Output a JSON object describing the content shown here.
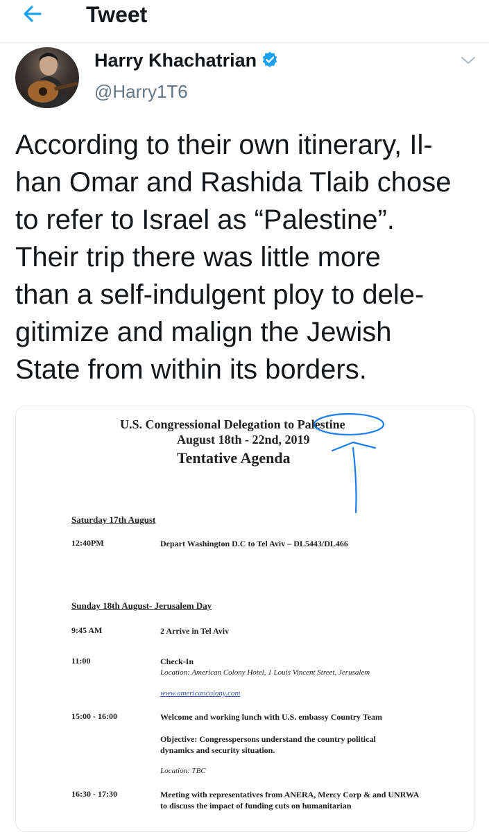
{
  "header": {
    "back_icon": "arrow-left-icon",
    "title": "Tweet"
  },
  "author": {
    "name": "Harry Khachatrian",
    "handle": "@Harry1T6",
    "verified_icon": "verified-badge-icon",
    "menu_icon": "chevron-down-icon"
  },
  "tweet": {
    "lines": [
      "According to their own itinerary, Il-",
      "han Omar and Rashida Tlaib chose",
      "to refer to Israel as “Palestine”.",
      "Their trip there was little more",
      "than a self-indulgent ploy to dele-",
      "gitimize and malign the Jewish",
      "State from within its borders."
    ]
  },
  "document": {
    "title": "U.S. Congressional Delegation to Palestine",
    "dates": "August 18th - 22nd, 2019",
    "agenda": "Tentative Agenda",
    "day1_heading": "Saturday 17th August",
    "day1_time": "12:40PM",
    "day1_desc": "Depart Washington D.C to Tel Aviv – DL5443/DL466",
    "day2_heading": "Sunday 18th August- Jerusalem Day",
    "items": {
      "t1": "9:45 AM",
      "d1": "2 Arrive in Tel Aviv",
      "t2": "11:00",
      "d2": "Check-In",
      "d2_location": "Location: American Colony Hotel, 1 Louis Vincent Street, Jerusalem",
      "d2_link": "www.americancolony.com",
      "t3": "15:00 - 16:00",
      "d3": "Welcome and working lunch with U.S. embassy Country Team",
      "d3_objective": "Objective: Congresspersons understand the country political dynamics and security situation.",
      "d3_location": "Location: TBC",
      "t4": "16:30 - 17:30",
      "d4": "Meeting with representatives from ANERA, Mercy Corp & and UNRWA to discuss the impact of funding cuts on humanitarian"
    }
  },
  "colors": {
    "accent": "#1da1f2",
    "text": "#14171a",
    "muted": "#657786",
    "annotation": "#1a7ef0"
  }
}
